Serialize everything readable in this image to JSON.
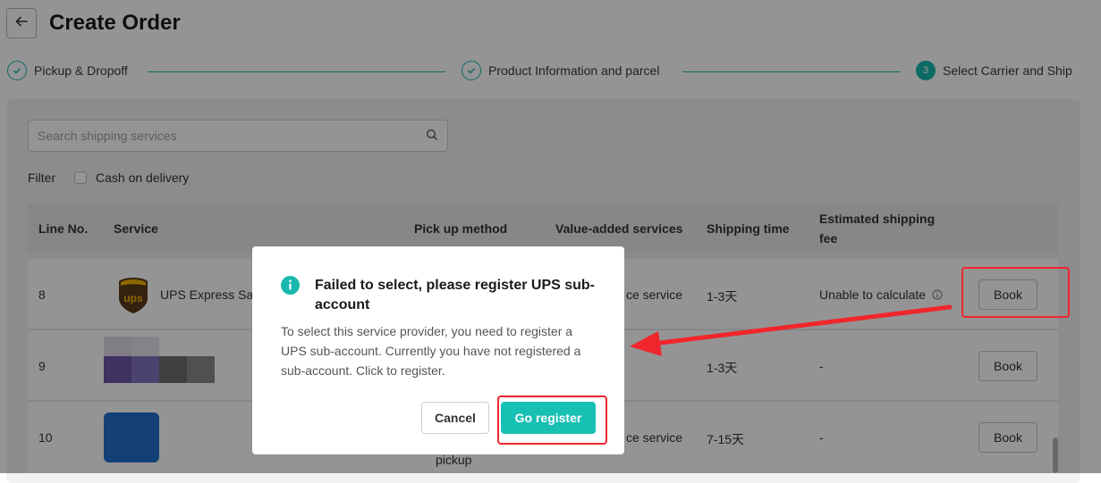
{
  "header": {
    "title": "Create Order"
  },
  "steps": [
    {
      "label": "Pickup & Dropoff",
      "state": "done"
    },
    {
      "label": "Product Information and parcel",
      "state": "done"
    },
    {
      "label": "Select Carrier and Ship",
      "state": "active",
      "number": "3"
    }
  ],
  "search": {
    "placeholder": "Search shipping services"
  },
  "filter": {
    "label": "Filter",
    "cash_on_delivery": "Cash on delivery"
  },
  "table": {
    "headers": {
      "line_no": "Line No.",
      "service": "Service",
      "pickup": "Pick up method",
      "vas": "Value-added services",
      "time": "Shipping time",
      "fee_line1": "Estimated shipping",
      "fee_line2": "fee"
    },
    "rows": [
      {
        "line": "8",
        "service": "UPS Express Sa",
        "vas": "ce service",
        "time": "1-3天",
        "fee": "Unable to calculate",
        "action": "Book"
      },
      {
        "line": "9",
        "service": "",
        "vas": "",
        "time": "1-3天",
        "fee": "-",
        "action": "Book"
      },
      {
        "line": "10",
        "service": "",
        "pickup": "pickup",
        "vas": "ce service",
        "time": "7-15天",
        "fee": "-",
        "action": "Book"
      }
    ]
  },
  "modal": {
    "title_line1": "Failed to select, please register UPS sub-",
    "title_line2": "account",
    "body_line1": "To select this service provider, you need to register a",
    "body_line2": "UPS sub-account. Currently you have not registered a",
    "body_line3": "sub-account. Click to register.",
    "cancel": "Cancel",
    "confirm": "Go register"
  },
  "colors": {
    "accent": "#18b8ae",
    "annotation": "#f0262c",
    "ups_brown": "#5a3a1a",
    "ups_gold": "#f5b400"
  }
}
